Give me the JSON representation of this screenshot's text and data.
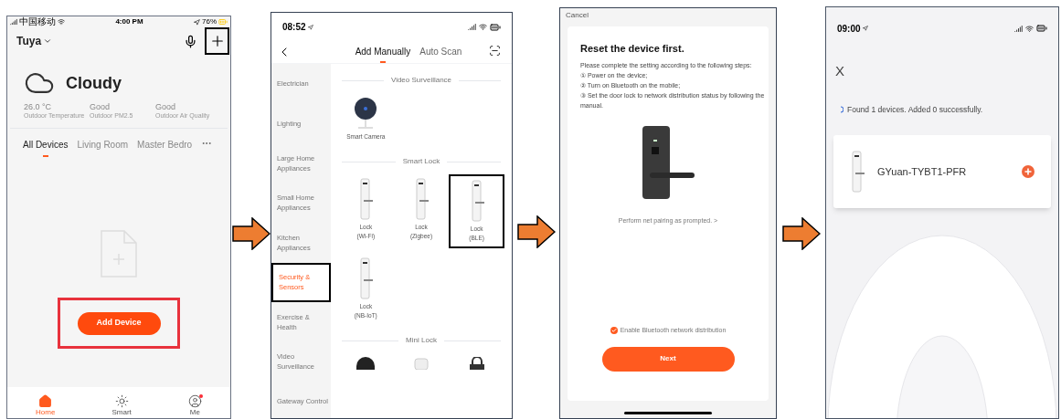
{
  "home_screen": {
    "status": {
      "carrier": "中国移动",
      "time": "4:00 PM",
      "battery": "76%"
    },
    "home_name": "Tuya",
    "add_highlighted": true,
    "weather": "Cloudy",
    "stats": [
      {
        "value": "26.0 °C",
        "label": "Outdoor Temperature"
      },
      {
        "value": "Good",
        "label": "Outdoor PM2.5"
      },
      {
        "value": "Good",
        "label": "Outdoor Air Quality"
      }
    ],
    "rooms": [
      {
        "label": "All Devices",
        "selected": true
      },
      {
        "label": "Living Room",
        "selected": false
      },
      {
        "label": "Master Bedro",
        "selected": false
      }
    ],
    "add_device": {
      "label": "Add Device",
      "highlighted": true
    },
    "nav": [
      {
        "label": "Home",
        "selected": true,
        "badge": false
      },
      {
        "label": "Smart",
        "selected": false,
        "badge": false
      },
      {
        "label": "Me",
        "selected": false,
        "badge": true
      }
    ]
  },
  "add_device_screen": {
    "time": "08:52",
    "tabs": [
      {
        "label": "Add Manually",
        "selected": true
      },
      {
        "label": "Auto Scan",
        "selected": false
      }
    ],
    "categories": [
      {
        "label": "Electrician",
        "selected": false,
        "highlighted": false
      },
      {
        "label": "Lighting",
        "selected": false,
        "highlighted": false
      },
      {
        "label": "Large Home Appliances",
        "selected": false,
        "highlighted": false
      },
      {
        "label": "Small Home Appliances",
        "selected": false,
        "highlighted": false
      },
      {
        "label": "Kitchen Appliances",
        "selected": false,
        "highlighted": false
      },
      {
        "label": "Security & Sensors",
        "selected": true,
        "highlighted": true
      },
      {
        "label": "Exercise & Health",
        "selected": false,
        "highlighted": false
      },
      {
        "label": "Video Surveillance",
        "selected": false,
        "highlighted": false
      },
      {
        "label": "Gateway Control",
        "selected": false,
        "highlighted": false
      }
    ],
    "sections": [
      {
        "title": "Video Surveillance",
        "devices": [
          {
            "kind": "camera",
            "name": "Smart Camera",
            "highlighted": false
          }
        ]
      },
      {
        "title": "Smart Lock",
        "devices": [
          {
            "kind": "lock",
            "name": "Lock",
            "detail": "(Wi-Fi)",
            "highlighted": false
          },
          {
            "kind": "lock",
            "name": "Lock",
            "detail": "(Zigbee)",
            "highlighted": false
          },
          {
            "kind": "lock",
            "name": "Lock",
            "detail": "(BLE)",
            "highlighted": true
          },
          {
            "kind": "lock",
            "name": "Lock",
            "detail": "(NB-IoT)",
            "highlighted": false
          }
        ]
      },
      {
        "title": "Mini Lock",
        "devices": [
          {
            "kind": "keypad",
            "highlighted": false
          },
          {
            "kind": "mini",
            "highlighted": false
          },
          {
            "kind": "padlock",
            "highlighted": false
          }
        ]
      }
    ]
  },
  "reset_screen": {
    "cancel": "Cancel",
    "title": "Reset the device first.",
    "intro": "Please complete the setting according to the following steps:",
    "steps": [
      "① Power on the device;",
      "② Turn on Bluetooth on the mobile;",
      "③ Set the door lock to network distribution status by following the manual."
    ],
    "link": "Perform net pairing as prompted. >",
    "checkbox": {
      "label": "Enable Bluetooth network distribution",
      "checked": true
    },
    "next": "Next"
  },
  "found_screen": {
    "time": "09:00",
    "close": "X",
    "status": "Found 1 devices. Added 0 successfully.",
    "device": "GYuan-TYBT1-PFR"
  }
}
